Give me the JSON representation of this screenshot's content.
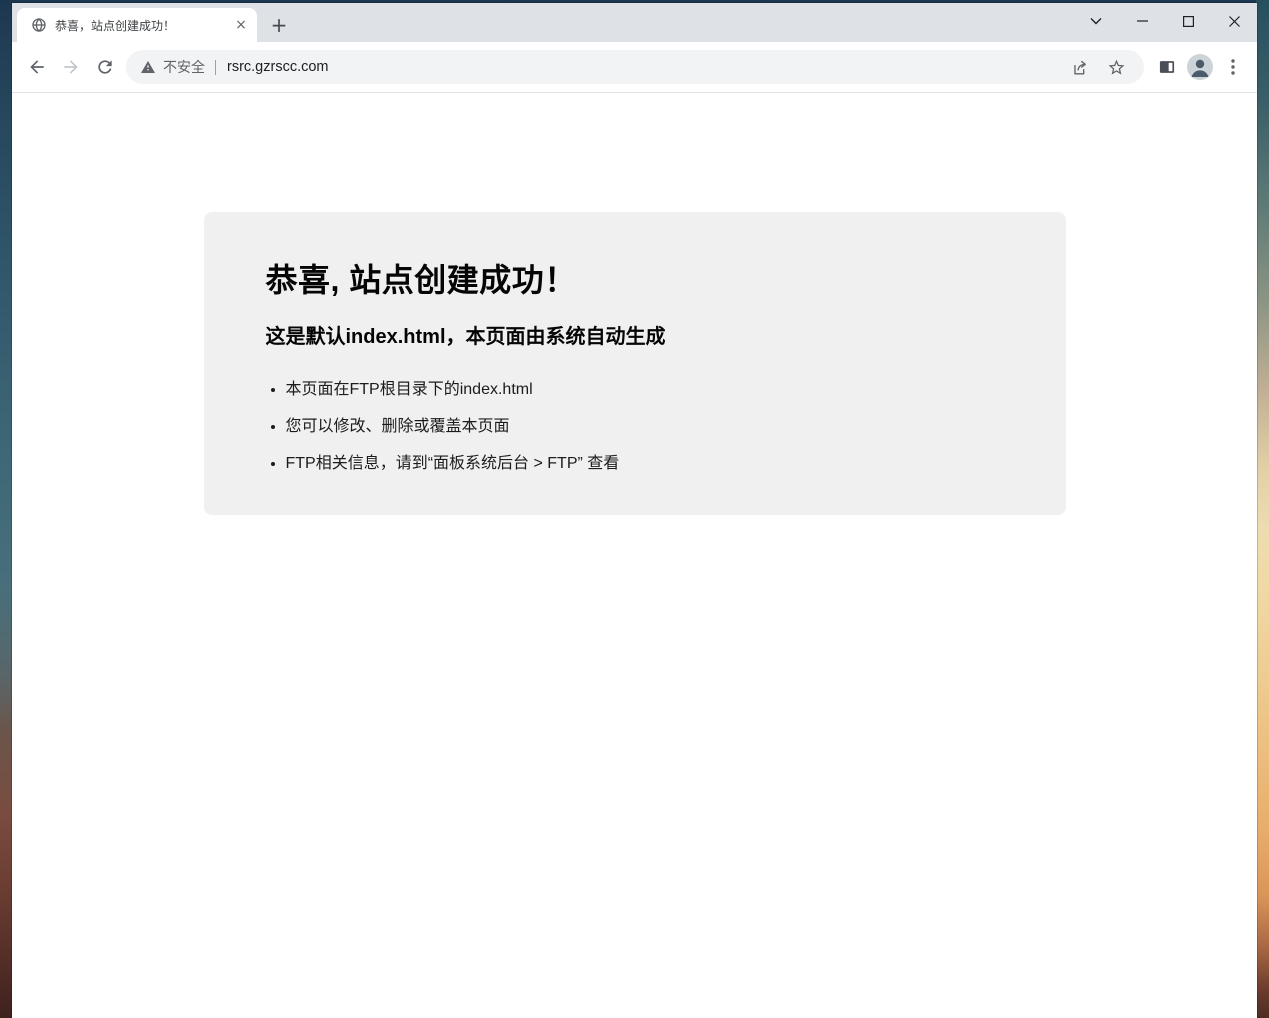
{
  "window": {
    "tab": {
      "title": "恭喜，站点创建成功！",
      "close_glyph": "×"
    },
    "new_tab_glyph": "+",
    "controls": [
      "tab-search",
      "minimize",
      "maximize",
      "close"
    ]
  },
  "toolbar": {
    "address_bar": {
      "security_label": "不安全",
      "url": "rsrc.gzrscc.com"
    }
  },
  "page": {
    "heading": "恭喜, 站点创建成功！",
    "subheading": "这是默认index.html，本页面由系统自动生成",
    "bullets": [
      "本页面在FTP根目录下的index.html",
      "您可以修改、删除或覆盖本页面",
      "FTP相关信息，请到“面板系统后台 > FTP” 查看"
    ]
  },
  "colors": {
    "tab_strip_bg": "#dee1e6",
    "omnibox_bg": "#f1f3f4",
    "info_box_bg": "#f0f0f0",
    "url_text": "#202124",
    "secondary_text": "#5f6368"
  }
}
